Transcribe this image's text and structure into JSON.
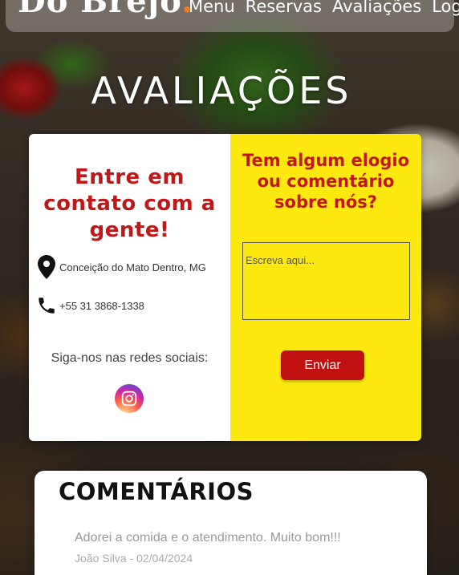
{
  "header": {
    "brand": "Do Brejo",
    "brand_dot": ".",
    "nav": [
      "Menu",
      "Reservas",
      "Avaliações",
      "Login"
    ]
  },
  "page": {
    "title": "AVALIAÇÕES"
  },
  "contact": {
    "heading": "Entre em contato com a gente!",
    "address": "Conceição do Mato Dentro, MG",
    "phone": "+55 31 3868-1338",
    "follow_label": "Siga-nos nas redes sociais:",
    "social_icon": "instagram-icon"
  },
  "feedback": {
    "heading": "Tem algum elogio ou comentário sobre nós?",
    "placeholder": "Escreva aqui...",
    "submit_label": "Enviar"
  },
  "comments": {
    "title": "COMENTÁRIOS",
    "items": [
      {
        "text": "Adorei a comida e o atendimento. Muito bom!!!",
        "author_date": "João Silva - 02/04/2024"
      }
    ]
  },
  "colors": {
    "accent_red": "#c01818",
    "panel_yellow": "#fde910",
    "brand_dot": "#f07d1c"
  }
}
